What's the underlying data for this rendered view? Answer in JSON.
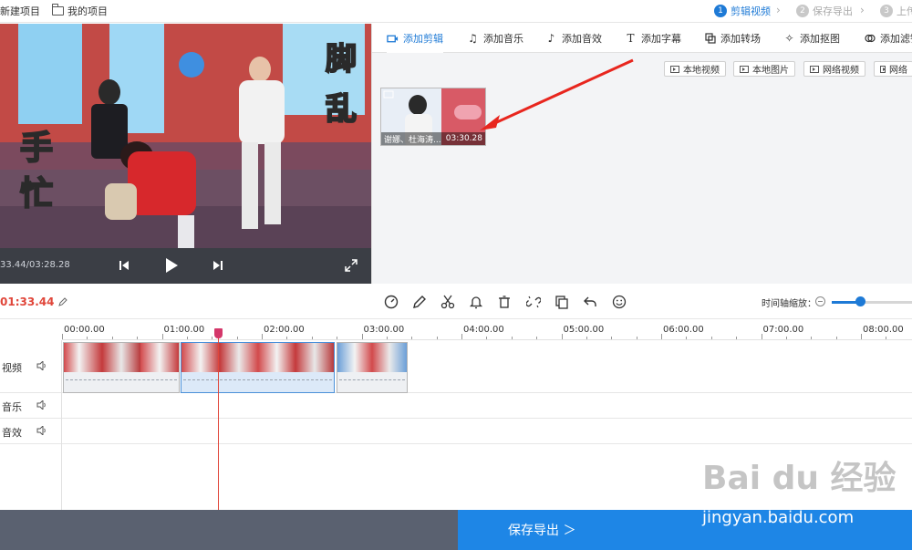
{
  "topbar": {
    "new_project": "新建项目",
    "my_projects": "我的项目",
    "steps": [
      {
        "num": "1",
        "label": "剪辑视频"
      },
      {
        "num": "2",
        "label": "保存导出"
      },
      {
        "num": "3",
        "label": "上传"
      }
    ]
  },
  "preview": {
    "time_display": "33.44/03:28.28",
    "overlay_left_1": "手",
    "overlay_left_2": "忙",
    "overlay_right_1": "脚",
    "overlay_right_2": "乱"
  },
  "tabs": [
    {
      "label": "添加剪辑",
      "icon": "video-camera-icon"
    },
    {
      "label": "添加音乐",
      "icon": "music-note-icon"
    },
    {
      "label": "添加音效",
      "icon": "sound-effect-icon"
    },
    {
      "label": "添加字幕",
      "icon": "text-icon"
    },
    {
      "label": "添加转场",
      "icon": "transition-icon"
    },
    {
      "label": "添加抠图",
      "icon": "magic-wand-icon"
    },
    {
      "label": "添加滤镜",
      "icon": "filter-icon"
    }
  ],
  "sources": {
    "local_video": "本地视频",
    "local_image": "本地图片",
    "web_video": "网络视频",
    "web_image": "网络"
  },
  "media_clip": {
    "title": "谢娜、杜海涛...",
    "duration": "03:30.28"
  },
  "toolbar": {
    "current_time": "01:33.44",
    "zoom_label": "时间轴缩放：",
    "zoom_level": 0.35
  },
  "timeline": {
    "ticks": [
      "00:00.00",
      "01:00.00",
      "02:00.00",
      "03:00.00",
      "04:00.00",
      "05:00.00",
      "06:00.00",
      "07:00.00",
      "08:00.00"
    ],
    "tracks": {
      "video": "视频",
      "music": "音乐",
      "sfx": "音效"
    }
  },
  "export": {
    "label": "保存导出 ＞"
  },
  "watermark": {
    "logo": "Bai du 经验",
    "url": "jingyan.baidu.com"
  },
  "colors": {
    "accent": "#1e7ad6",
    "playhead": "#e0463a",
    "export": "#1e86e6"
  }
}
